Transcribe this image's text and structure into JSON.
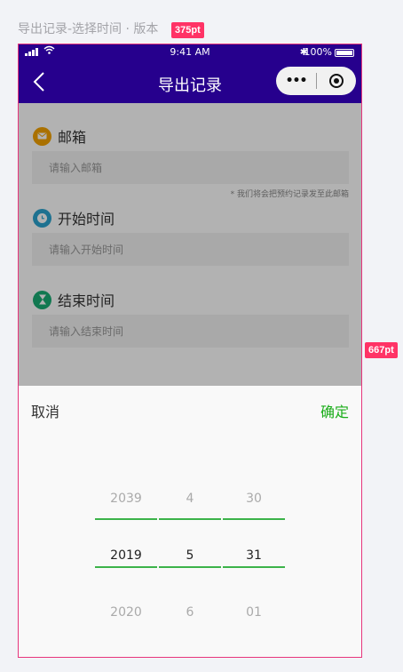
{
  "caption": "导出记录-选择时间 · 版本",
  "dimension_tags": {
    "width": "375pt",
    "height": "667pt"
  },
  "status_bar": {
    "time": "9:41 AM",
    "bluetooth": "✱",
    "battery": "100%"
  },
  "nav": {
    "title": "导出记录"
  },
  "form": {
    "email": {
      "label": "邮箱",
      "placeholder": "请输入邮箱",
      "hint": "* 我们将会把预约记录发至此邮箱"
    },
    "start": {
      "label": "开始时间",
      "placeholder": "请输入开始时间"
    },
    "end": {
      "label": "结束时间",
      "placeholder": "请输入结束时间"
    }
  },
  "picker": {
    "cancel": "取消",
    "confirm": "确定",
    "year": {
      "prev": "2039",
      "selected": "2019",
      "next": "2020"
    },
    "month": {
      "prev": "4",
      "selected": "5",
      "next": "6"
    },
    "day": {
      "prev": "30",
      "selected": "31",
      "next": "01"
    }
  },
  "colors": {
    "nav_bg": "#26008d",
    "email_icon": "#f4a300",
    "start_icon": "#2aa3cf",
    "end_icon": "#1aad74",
    "confirm": "#1aad19",
    "picker_line": "#3cb34a",
    "tag": "#ff3366"
  },
  "icons": {
    "email": "mail-icon",
    "start": "clock-icon",
    "end": "hourglass-icon",
    "back": "chevron-left-icon",
    "more": "more-dots-icon",
    "close": "target-close-icon"
  }
}
